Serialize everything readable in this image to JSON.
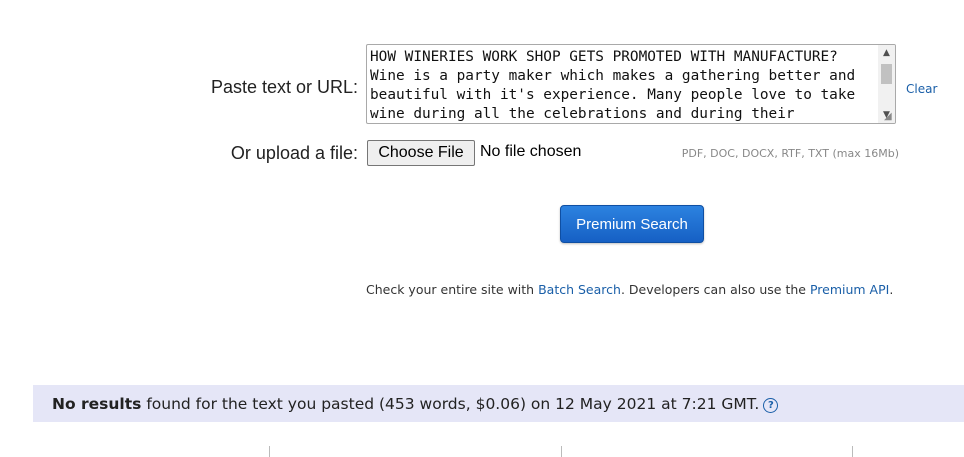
{
  "form": {
    "paste_label": "Paste text or URL:",
    "textarea_value": "HOW WINERIES WORK SHOP GETS PROMOTED WITH MANUFACTURE?\nWine is a party maker which makes a gathering better and beautiful with it's experience. Many people love to take wine during all the celebrations and during their",
    "clear_label": "Clear",
    "upload_label": "Or upload a file:",
    "choose_file_label": "Choose File",
    "file_status": "No file chosen",
    "formats_hint": "PDF, DOC, DOCX, RTF, TXT (max 16Mb)"
  },
  "premium_button_label": "Premium Search",
  "info": {
    "prefix": "Check your entire site with ",
    "batch_link": "Batch Search",
    "middle": ". Developers can also use the ",
    "api_link": "Premium API",
    "suffix": "."
  },
  "results": {
    "bold": "No results",
    "text": " found for the text you pasted (453 words, $0.06) on 12 May 2021 at 7:21 GMT.",
    "help_icon": "question-circle-icon"
  },
  "colors": {
    "link": "#1a5fa8",
    "button": "#1660c4",
    "results_bg": "#e5e6f7"
  }
}
